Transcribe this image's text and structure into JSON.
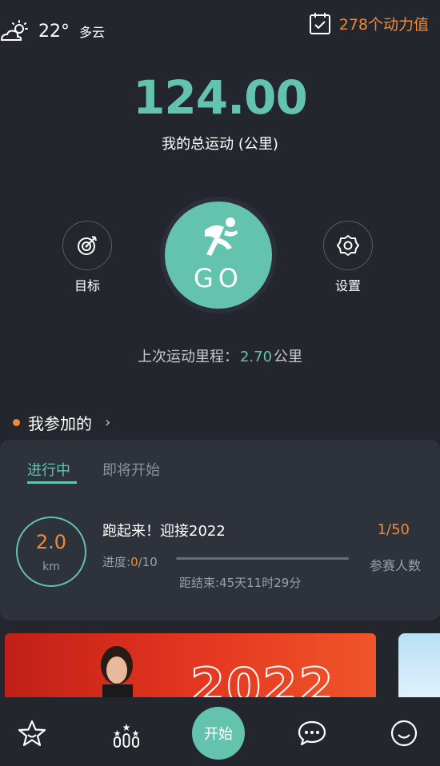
{
  "weather": {
    "temperature": "22°",
    "condition": "多云",
    "icon": "partly-cloudy-icon"
  },
  "power": {
    "label": "278个动力值",
    "icon": "calendar-check-icon"
  },
  "total": {
    "value": "124.00",
    "label": "我的总运动 (公里)"
  },
  "actions": {
    "target_label": "目标",
    "go_label": "GO",
    "settings_label": "设置"
  },
  "last_run": {
    "prefix": "上次运动里程：",
    "value": "2.70",
    "unit": "公里"
  },
  "joined": {
    "title": "我参加的",
    "chevron": "›"
  },
  "tabs": {
    "active": "进行中",
    "upcoming": "即将开始"
  },
  "event": {
    "distance_value": "2.0",
    "distance_unit": "km",
    "title": "跑起来！迎接2022",
    "progress_prefix": "进度:",
    "progress_current": "0",
    "progress_total": "/10",
    "progress_fraction": 0.0,
    "countdown": "距结束:45天11时29分",
    "participants_value": "1/50",
    "participants_label": "参赛人数"
  },
  "banner": {
    "year_text": "2022"
  },
  "nav": {
    "start_label": "开始"
  },
  "colors": {
    "accent": "#64c3ad",
    "orange": "#ee8a3b",
    "background": "#23262d",
    "card": "#2e323a"
  }
}
